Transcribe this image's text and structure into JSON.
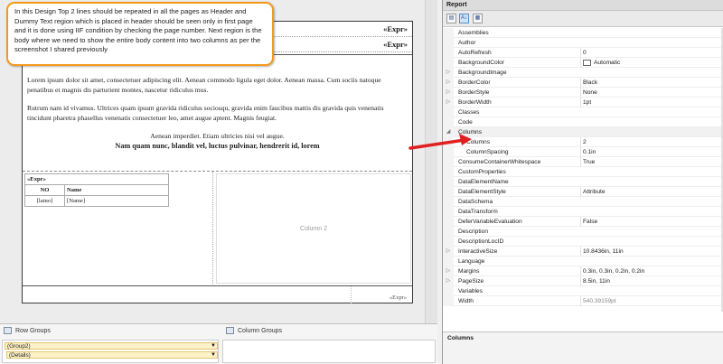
{
  "designer": {
    "header_expr_1": "«Expr»",
    "header_expr_2": "«Expr»",
    "footer_expr": "«Expr»",
    "body": {
      "para1": "Lorem ipsum dolor sit amet, consectetuer adipiscing elit. Aenean commodo ligula eget dolor. Aenean massa. Cum sociis natoque penatibus et magnis dis parturient montes, nascetur ridiculus mus.",
      "para2": "Rutrum nam id vivamus. Ultrices quam ipsum gravida ridiculus sociosqu, gravida enim faucibus mattis dis gravida quis venenatis tincidunt pharetra phasellus venenatis consectetuer leo, amet augue aptent. Magnis feugiat.",
      "line3": "Aenean imperdiet. Etiam ultricies nisi vel augue.",
      "line4": "Nam quam nunc, blandit vel, luctus pulvinar, hendrerit id, lorem"
    },
    "table": {
      "group_header": "«Expr»",
      "col_no": "NO",
      "col_name": "Name",
      "cell_no": "[latno]",
      "cell_name": "[Name]"
    },
    "column2_label": "Column 2"
  },
  "callout": {
    "text": "In this Design Top 2 lines should be repeated in all the pages as Header and Dummy Text region which is placed in header should be seen only in first page and it is done using IIF condition by checking the page number. Next region is the body where we need to show the entire body content into two columns as per the screenshot I shared previously"
  },
  "group_panes": {
    "row_groups_title": "Row Groups",
    "column_groups_title": "Column Groups",
    "row_items": [
      "(Group2)",
      "(Details)"
    ]
  },
  "properties": {
    "panel_title": "Report",
    "description_title": "Columns",
    "rows": [
      {
        "name": "Assemblies",
        "value": "",
        "kind": "normal"
      },
      {
        "name": "Author",
        "value": "",
        "kind": "normal"
      },
      {
        "name": "AutoRefresh",
        "value": "0",
        "kind": "normal"
      },
      {
        "name": "BackgroundColor",
        "value": "Automatic",
        "kind": "swatch"
      },
      {
        "name": "BackgroundImage",
        "value": "",
        "kind": "expand"
      },
      {
        "name": "BorderColor",
        "value": "Black",
        "kind": "expand"
      },
      {
        "name": "BorderStyle",
        "value": "None",
        "kind": "expand"
      },
      {
        "name": "BorderWidth",
        "value": "1pt",
        "kind": "expand"
      },
      {
        "name": "Classes",
        "value": "",
        "kind": "normal"
      },
      {
        "name": "Code",
        "value": "",
        "kind": "normal"
      },
      {
        "name": "Columns",
        "value": "",
        "kind": "category"
      },
      {
        "name": "Columns",
        "value": "2",
        "kind": "sub"
      },
      {
        "name": "ColumnSpacing",
        "value": "0.1in",
        "kind": "sub"
      },
      {
        "name": "ConsumeContainerWhitespace",
        "value": "True",
        "kind": "normal"
      },
      {
        "name": "CustomProperties",
        "value": "",
        "kind": "normal"
      },
      {
        "name": "DataElementName",
        "value": "",
        "kind": "normal"
      },
      {
        "name": "DataElementStyle",
        "value": "Attribute",
        "kind": "normal"
      },
      {
        "name": "DataSchema",
        "value": "",
        "kind": "normal"
      },
      {
        "name": "DataTransform",
        "value": "",
        "kind": "normal"
      },
      {
        "name": "DeferVariableEvaluation",
        "value": "False",
        "kind": "normal"
      },
      {
        "name": "Description",
        "value": "",
        "kind": "normal"
      },
      {
        "name": "DescriptionLocID",
        "value": "",
        "kind": "normal"
      },
      {
        "name": "InteractiveSize",
        "value": "10.8436in, 11in",
        "kind": "expand"
      },
      {
        "name": "Language",
        "value": "",
        "kind": "normal"
      },
      {
        "name": "Margins",
        "value": "0.3in, 0.3in, 0.2in, 0.2in",
        "kind": "expand"
      },
      {
        "name": "PageSize",
        "value": "8.5in, 11in",
        "kind": "expand"
      },
      {
        "name": "Variables",
        "value": "",
        "kind": "normal"
      },
      {
        "name": "Width",
        "value": "540.39159pt",
        "kind": "grey"
      }
    ]
  },
  "colors": {
    "callout_border": "#f39a1d",
    "arrow": "#e02020"
  }
}
